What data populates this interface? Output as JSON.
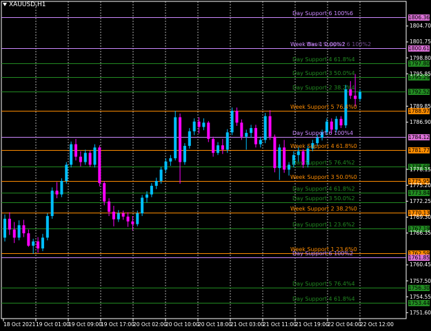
{
  "symbol": "XAUUSD,H1",
  "colors": {
    "background": "#000000",
    "bull": "#00bfff",
    "bear": "#ff00ff",
    "day_support_6": "#cc88ff",
    "week_fib": "#ff8c00",
    "support_green": "#228b22",
    "grid": "#ffffff",
    "box_day6": "#da70d6",
    "box_week": "#ff8c00",
    "box_green": "#228b22"
  },
  "levels": [
    {
      "name": "Day Support 6 100%6",
      "price": 1806.36,
      "price_label": "1806.36",
      "color": "#cc88ff",
      "box": "#da70d6"
    },
    {
      "name": "Week Bas 1 0.00%2",
      "price": 1800.61,
      "price_label": "1800.61",
      "color": "#cc88ff",
      "box": "#da70d6",
      "extra_label": "Week Support 6 100%2"
    },
    {
      "name": "Day Support 4 61.8%4",
      "price": 1797.8,
      "price_label": "1797.80",
      "color": "#228b22",
      "box": "#228b22"
    },
    {
      "name": "Day Support 3 50.0%4",
      "price": 1795.29,
      "price_label": "1795.29",
      "color": "#228b22",
      "box": "#228b22"
    },
    {
      "name": "Day Support 2 38.2%4",
      "price": 1792.52,
      "price_label": "1792.52",
      "color": "#228b22",
      "box": "#228b22"
    },
    {
      "name": "Week Support 5 76.4%0",
      "price": 1788.97,
      "price_label": "1788.97",
      "color": "#ff8c00",
      "box": "#ff8c00"
    },
    {
      "name": "Day Support 6 100%4",
      "price": 1784.12,
      "price_label": "1784.12",
      "color": "#cc88ff",
      "box": "#da70d6"
    },
    {
      "name": "Week Support 4 61.8%0",
      "price": 1781.77,
      "price_label": "1781.77",
      "color": "#ff8c00",
      "box": "#ff8c00"
    },
    {
      "name": "Day Support 5 76.4%2",
      "price": 1778.69,
      "price_label": "1778.69",
      "color": "#228b22",
      "box": "#228b22"
    },
    {
      "name": "Week Support 3 50.0%0",
      "price": 1775.95,
      "price_label": "1775.95",
      "color": "#ff8c00",
      "box": "#ff8c00"
    },
    {
      "name": "Day Support 4 61.8%2",
      "price": 1773.84,
      "price_label": "1773.84",
      "color": "#228b22",
      "box": "#228b22"
    },
    {
      "name": "Day Support 3 50.0%2",
      "price": 1772.0,
      "price_label": "",
      "color": "#228b22",
      "box": ""
    },
    {
      "name": "Week Support 2 38.2%0",
      "price": 1770.13,
      "price_label": "1770.13",
      "color": "#ff8c00",
      "box": "#ff8c00"
    },
    {
      "name": "Day Support 1 23.6%2",
      "price": 1767.19,
      "price_label": "1767.19",
      "color": "#228b22",
      "box": "#228b22"
    },
    {
      "name": "Week Support 1 23.6%0",
      "price": 1762.59,
      "price_label": "1762.59",
      "color": "#ff8c00",
      "box": "#ff8c00"
    },
    {
      "name": "Day Support 6 100%2",
      "price": 1761.85,
      "price_label": "1761.85",
      "color": "#cc88ff",
      "box": "#da70d6"
    },
    {
      "name": "Day Support 5 76.4%4",
      "price": 1756.3,
      "price_label": "1756.30",
      "color": "#228b22",
      "box": "#228b22"
    },
    {
      "name": "Day Support 4 61.8%4",
      "price": 1753.44,
      "price_label": "1753.44",
      "color": "#228b22",
      "box": "#228b22"
    }
  ],
  "price_ticks": [
    "1804.70",
    "1801.75",
    "1798.80",
    "1795.85",
    "1789.85",
    "1786.90",
    "1778.15",
    "1775.20",
    "1772.25",
    "1769.30",
    "1766.35",
    "1760.45",
    "1757.50",
    "1754.55",
    "1751.60"
  ],
  "time_ticks": [
    "18 Oct 2021",
    "19 Oct 01:00",
    "19 Oct 09:00",
    "19 Oct 17:00",
    "20 Oct 02:00",
    "20 Oct 10:00",
    "20 Oct 18:00",
    "21 Oct 03:00",
    "21 Oct 11:00",
    "21 Oct 19:00",
    "22 Oct 04:00",
    "22 Oct 12:00"
  ],
  "chart_data": {
    "type": "candlestick",
    "symbol": "XAUUSD",
    "timeframe": "H1",
    "ylim": [
      1750.5,
      1808.5
    ],
    "candles": [
      [
        1765.5,
        1769.8,
        1764.8,
        1769.0
      ],
      [
        1769.0,
        1770.2,
        1766.0,
        1767.0
      ],
      [
        1767.0,
        1768.4,
        1764.5,
        1765.5
      ],
      [
        1765.5,
        1768.7,
        1765.0,
        1767.8
      ],
      [
        1767.8,
        1768.8,
        1765.6,
        1766.3
      ],
      [
        1766.3,
        1767.0,
        1763.8,
        1764.0
      ],
      [
        1764.0,
        1765.3,
        1762.5,
        1764.8
      ],
      [
        1764.8,
        1765.6,
        1762.7,
        1763.5
      ],
      [
        1763.5,
        1766.2,
        1763.0,
        1765.5
      ],
      [
        1765.5,
        1770.0,
        1765.0,
        1769.5
      ],
      [
        1769.5,
        1774.8,
        1769.0,
        1774.2
      ],
      [
        1774.2,
        1775.8,
        1772.8,
        1773.5
      ],
      [
        1773.5,
        1776.5,
        1773.0,
        1776.0
      ],
      [
        1776.0,
        1779.5,
        1775.5,
        1779.0
      ],
      [
        1779.0,
        1783.3,
        1778.5,
        1782.8
      ],
      [
        1782.8,
        1783.8,
        1779.8,
        1780.5
      ],
      [
        1780.5,
        1781.5,
        1778.7,
        1779.5
      ],
      [
        1779.5,
        1781.8,
        1779.0,
        1781.2
      ],
      [
        1781.2,
        1781.6,
        1778.6,
        1779.0
      ],
      [
        1779.0,
        1782.8,
        1778.5,
        1782.2
      ],
      [
        1782.2,
        1782.6,
        1775.0,
        1775.6
      ],
      [
        1775.6,
        1776.0,
        1771.5,
        1772.2
      ],
      [
        1772.2,
        1772.8,
        1769.5,
        1770.3
      ],
      [
        1770.3,
        1771.4,
        1767.6,
        1768.9
      ],
      [
        1768.9,
        1770.6,
        1768.4,
        1770.0
      ],
      [
        1770.0,
        1770.5,
        1768.8,
        1769.4
      ],
      [
        1769.4,
        1770.2,
        1767.5,
        1768.5
      ],
      [
        1768.5,
        1769.5,
        1766.8,
        1768.0
      ],
      [
        1768.0,
        1770.5,
        1767.6,
        1770.0
      ],
      [
        1770.0,
        1773.4,
        1769.5,
        1772.9
      ],
      [
        1772.9,
        1774.1,
        1772.0,
        1773.5
      ],
      [
        1773.5,
        1775.6,
        1773.0,
        1775.1
      ],
      [
        1775.1,
        1776.6,
        1774.5,
        1776.0
      ],
      [
        1776.0,
        1778.6,
        1775.5,
        1778.1
      ],
      [
        1778.1,
        1780.2,
        1777.5,
        1779.6
      ],
      [
        1779.6,
        1780.8,
        1778.8,
        1780.2
      ],
      [
        1780.2,
        1789.0,
        1779.8,
        1787.8
      ],
      [
        1787.8,
        1788.5,
        1775.5,
        1779.5
      ],
      [
        1779.5,
        1783.0,
        1779.0,
        1782.5
      ],
      [
        1782.5,
        1785.8,
        1782.0,
        1785.2
      ],
      [
        1785.2,
        1787.6,
        1784.5,
        1787.0
      ],
      [
        1787.0,
        1787.8,
        1784.8,
        1786.0
      ],
      [
        1786.0,
        1787.6,
        1785.4,
        1786.8
      ],
      [
        1786.8,
        1787.1,
        1783.2,
        1783.8
      ],
      [
        1783.8,
        1784.2,
        1780.5,
        1781.2
      ],
      [
        1781.2,
        1783.2,
        1780.8,
        1782.6
      ],
      [
        1782.6,
        1783.8,
        1781.0,
        1781.8
      ],
      [
        1781.8,
        1785.6,
        1781.2,
        1785.0
      ],
      [
        1785.0,
        1789.6,
        1784.5,
        1789.0
      ],
      [
        1789.0,
        1789.6,
        1786.2,
        1786.8
      ],
      [
        1786.8,
        1787.4,
        1783.6,
        1784.2
      ],
      [
        1784.2,
        1785.5,
        1781.8,
        1784.9
      ],
      [
        1784.9,
        1786.4,
        1784.0,
        1785.8
      ],
      [
        1785.8,
        1786.4,
        1782.2,
        1782.8
      ],
      [
        1782.8,
        1784.2,
        1782.2,
        1783.6
      ],
      [
        1783.6,
        1788.6,
        1783.0,
        1788.0
      ],
      [
        1788.0,
        1789.1,
        1783.6,
        1784.2
      ],
      [
        1784.2,
        1784.6,
        1777.6,
        1778.4
      ],
      [
        1778.4,
        1782.8,
        1776.2,
        1782.2
      ],
      [
        1782.2,
        1783.6,
        1777.5,
        1778.1
      ],
      [
        1778.1,
        1779.5,
        1777.0,
        1779.0
      ],
      [
        1779.0,
        1781.5,
        1778.5,
        1780.8
      ],
      [
        1780.8,
        1782.3,
        1779.5,
        1781.5
      ],
      [
        1781.5,
        1781.9,
        1778.4,
        1779.0
      ],
      [
        1779.0,
        1782.5,
        1778.5,
        1782.0
      ],
      [
        1782.0,
        1783.6,
        1781.5,
        1783.0
      ],
      [
        1783.0,
        1784.6,
        1782.5,
        1784.0
      ],
      [
        1784.0,
        1785.5,
        1783.5,
        1785.0
      ],
      [
        1785.0,
        1787.6,
        1784.5,
        1787.0
      ],
      [
        1787.0,
        1787.6,
        1784.8,
        1785.5
      ],
      [
        1785.5,
        1788.0,
        1785.0,
        1787.5
      ],
      [
        1787.5,
        1788.0,
        1785.8,
        1786.3
      ],
      [
        1786.3,
        1793.8,
        1785.8,
        1793.0
      ],
      [
        1793.0,
        1794.5,
        1791.2,
        1791.8
      ],
      [
        1791.8,
        1795.8,
        1789.8,
        1791.2
      ],
      [
        1791.2,
        1793.0,
        1790.8,
        1792.5
      ]
    ]
  }
}
